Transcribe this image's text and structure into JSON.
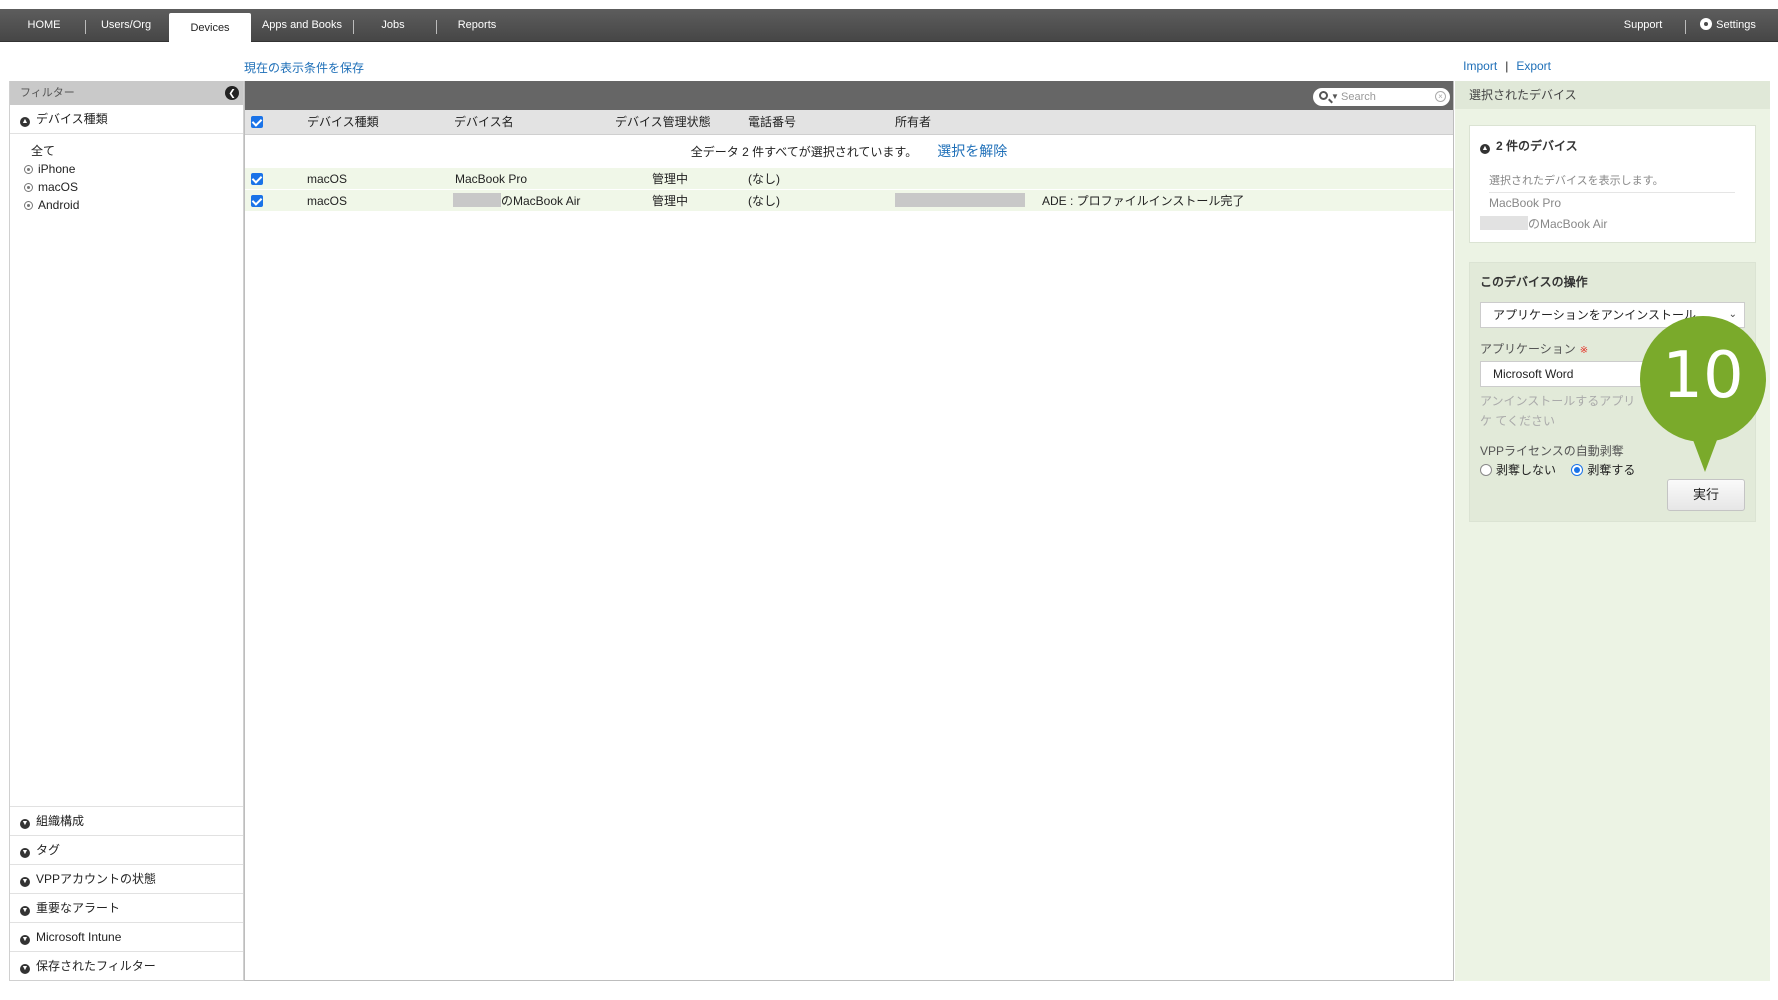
{
  "nav": {
    "tabs": [
      {
        "label": "HOME"
      },
      {
        "label": "Users/Org"
      },
      {
        "label": "Devices"
      },
      {
        "label": "Apps and Books"
      },
      {
        "label": "Jobs"
      },
      {
        "label": "Reports"
      }
    ],
    "active_tab": "Devices",
    "support": "Support",
    "settings": "Settings"
  },
  "toolbar": {
    "save_view": "現在の表示条件を保存",
    "import": "Import",
    "export": "Export"
  },
  "filter": {
    "title": "フィルター",
    "device_type_section": "デバイス種類",
    "device_types": [
      "全て",
      "iPhone",
      "macOS",
      "Android"
    ],
    "sections": [
      "組織構成",
      "タグ",
      "VPPアカウントの状態",
      "重要なアラート",
      "Microsoft Intune",
      "保存されたフィルター"
    ]
  },
  "table": {
    "search_placeholder": "Search",
    "columns": [
      "デバイス種類",
      "デバイス名",
      "デバイス管理状態",
      "電話番号",
      "所有者"
    ],
    "select_all_message": "全データ 2 件すべてが選択されています。",
    "deselect_link": "選択を解除",
    "rows": [
      {
        "type": "macOS",
        "name": "MacBook Pro",
        "status": "管理中",
        "phone": "(なし)",
        "owner": "",
        "note": ""
      },
      {
        "type": "macOS",
        "name": "のMacBook Air",
        "status": "管理中",
        "phone": "(なし)",
        "owner": "",
        "note": "ADE : プロファイルインストール完了"
      }
    ]
  },
  "right_panel": {
    "title": "選択されたデバイス",
    "count_label": "2 件のデバイス",
    "hint": "選択されたデバイスを表示します。",
    "devices": [
      "MacBook Pro",
      "のMacBook Air"
    ],
    "ops_title": "このデバイスの操作",
    "operation": "アプリケーションをアンインストール",
    "app_label": "アプリケーション",
    "required_mark": "※",
    "app_value": "Microsoft Word",
    "help_text": "アンインストールするアプリケ てください",
    "vpp_label": "VPPライセンスの自動剥奪",
    "radio_no": "剥奪しない",
    "radio_yes": "剥奪する",
    "run_button": "実行"
  },
  "callout": {
    "number": "10",
    "color": "#7aaa2b"
  }
}
